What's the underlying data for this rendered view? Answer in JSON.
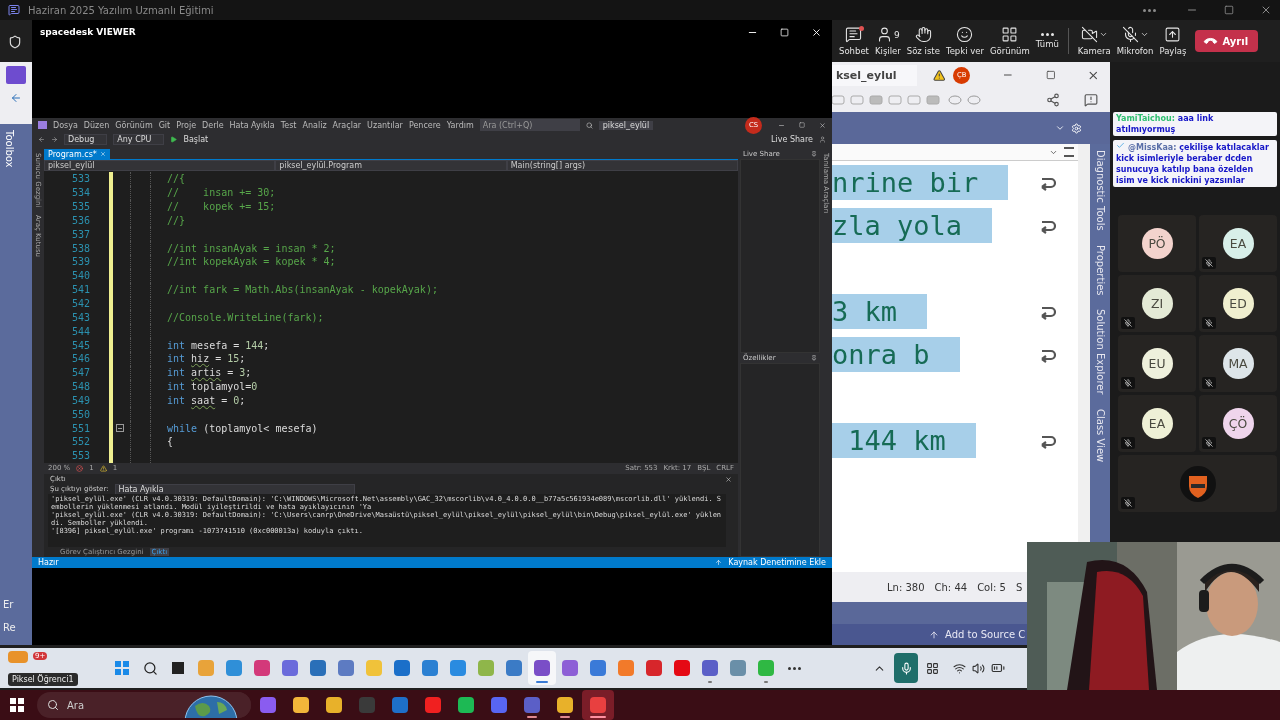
{
  "teams": {
    "title": "Haziran 2025 Yazılım Uzmanlı Eğitimi",
    "tools": [
      {
        "kind": "chat",
        "label": "Sohbet",
        "unread": true
      },
      {
        "kind": "people",
        "label": "Kişiler",
        "count": "9"
      },
      {
        "kind": "hand",
        "label": "Söz iste"
      },
      {
        "kind": "react",
        "label": "Tepki ver"
      },
      {
        "kind": "view",
        "label": "Görünüm"
      },
      {
        "kind": "more",
        "label": "Tümü"
      },
      {
        "kind": "camera",
        "label": "Kamera",
        "menu": true
      },
      {
        "kind": "mic",
        "label": "Mikrofon",
        "menu": true
      },
      {
        "kind": "share",
        "label": "Paylaş"
      }
    ],
    "leave": "Ayrıl"
  },
  "vs_background": {
    "title": "ksel_eylul",
    "user_initials": "ÇB",
    "left_tab": "Toolbox",
    "left_items": [
      "Er",
      "Re"
    ],
    "lines": [
      {
        "kind": "text",
        "text": "nrine bir"
      },
      {
        "kind": "text",
        "text": "zla yola"
      },
      {
        "kind": "blank"
      },
      {
        "kind": "text",
        "text": "3 km"
      },
      {
        "kind": "text",
        "text": "onra b"
      },
      {
        "kind": "blank"
      },
      {
        "kind": "text",
        "text": " 144 km"
      }
    ],
    "side_tabs": [
      "Diagnostic Tools",
      "Properties",
      "Solution Explorer",
      "Class View"
    ],
    "status": [
      "Ln: 380",
      "Ch: 44",
      "Col: 5",
      "S"
    ],
    "source_control": "Add to Source C"
  },
  "viewer": {
    "title": "spacedesk VIEWER"
  },
  "vs": {
    "menu": [
      "Dosya",
      "Düzen",
      "Görünüm",
      "Git",
      "Proje",
      "Derle",
      "Hata Ayıkla",
      "Test",
      "Analiz",
      "Araçlar",
      "Uzantılar",
      "Pencere",
      "Yardım"
    ],
    "search": {
      "placeholder": "Ara (Ctrl+Q)"
    },
    "solution": "piksel_eylül",
    "user_initials": "CS",
    "live_share": "Live Share",
    "config": "Debug",
    "platform": "Any CPU",
    "start": "Başlat",
    "left_tabs": [
      "Sunucu Gezgini",
      "Araç Kutusu"
    ],
    "right_tab": "Tanılama Araçları",
    "tabs": [
      {
        "label": "Program.cs*",
        "selected": true
      }
    ],
    "nav": [
      "piksel_eylül",
      "piksel_eylül.Program",
      "Main(string[] args)"
    ],
    "code": [
      {
        "n": "533",
        "segments": [
          {
            "kind": "comment",
            "text": "//{"
          }
        ]
      },
      {
        "n": "534",
        "segments": [
          {
            "kind": "comment",
            "text": "//    insan += 30;"
          }
        ]
      },
      {
        "n": "535",
        "segments": [
          {
            "kind": "comment",
            "text": "//    kopek += 15;"
          }
        ]
      },
      {
        "n": "536",
        "segments": [
          {
            "kind": "comment",
            "text": "//}"
          }
        ]
      },
      {
        "n": "537"
      },
      {
        "n": "538",
        "segments": [
          {
            "kind": "comment",
            "text": "//int insanAyak = insan * 2;"
          }
        ]
      },
      {
        "n": "539",
        "segments": [
          {
            "kind": "comment",
            "text": "//int kopekAyak = kopek * 4;"
          }
        ]
      },
      {
        "n": "540"
      },
      {
        "n": "541",
        "segments": [
          {
            "kind": "comment",
            "text": "//int fark = Math.Abs(insanAyak - kopekAyak);"
          }
        ]
      },
      {
        "n": "542"
      },
      {
        "n": "543",
        "segments": [
          {
            "kind": "comment",
            "text": "//Console.WriteLine(fark);"
          }
        ]
      },
      {
        "n": "544"
      },
      {
        "n": "545",
        "segments": [
          {
            "kind": "keyword",
            "text": "int"
          },
          {
            "kind": "plain",
            "text": " mesefa = "
          },
          {
            "kind": "number",
            "text": "144"
          },
          {
            "kind": "plain",
            "text": ";"
          }
        ]
      },
      {
        "n": "546",
        "segments": [
          {
            "kind": "keyword",
            "text": "int"
          },
          {
            "kind": "warned",
            "text": " hiz"
          },
          {
            "kind": "plain",
            "text": " = "
          },
          {
            "kind": "number",
            "text": "15"
          },
          {
            "kind": "plain",
            "text": ";"
          }
        ]
      },
      {
        "n": "547",
        "segments": [
          {
            "kind": "keyword",
            "text": "int"
          },
          {
            "kind": "warned",
            "text": " artis"
          },
          {
            "kind": "plain",
            "text": " = "
          },
          {
            "kind": "number",
            "text": "3"
          },
          {
            "kind": "plain",
            "text": ";"
          }
        ]
      },
      {
        "n": "548",
        "segments": [
          {
            "kind": "keyword",
            "text": "int"
          },
          {
            "kind": "plain",
            "text": " toplamyol="
          },
          {
            "kind": "number",
            "text": "0"
          }
        ]
      },
      {
        "n": "549",
        "segments": [
          {
            "kind": "keyword",
            "text": "int"
          },
          {
            "kind": "warned",
            "text": " saat"
          },
          {
            "kind": "plain",
            "text": " = "
          },
          {
            "kind": "number",
            "text": "0"
          },
          {
            "kind": "plain",
            "text": ";"
          }
        ]
      },
      {
        "n": "550"
      },
      {
        "n": "551",
        "foldable": true,
        "segments": [
          {
            "kind": "keyword",
            "text": "while"
          },
          {
            "kind": "plain",
            "text": " (toplamyol< mesefa)"
          }
        ]
      },
      {
        "n": "552",
        "segments": [
          {
            "kind": "plain",
            "text": "{"
          }
        ]
      },
      {
        "n": "553"
      }
    ],
    "editor_status": {
      "zoom": "200 %",
      "errors": "1",
      "warnings": "1",
      "line": "Satr: 553",
      "col": "Krkt: 17",
      "mode": "BŞL",
      "eol": "CRLF"
    },
    "output": {
      "title": "Çıktı",
      "show_label": "Şu çıktıyı göster:",
      "source": "Hata Ayıkla",
      "lines": [
        "'piksel_eylül.exe' (CLR v4.0.30319: DefaultDomain): 'C:\\WINDOWS\\Microsoft.Net\\assembly\\GAC_32\\mscorlib\\v4.0_4.0.0.0__b77a5c561934e089\\mscorlib.dll' yüklendi. Sembollerin yüklenmesi atlandı. Modül iyileştirildi ve hata ayıklayıcının 'Ya",
        "'piksel_eylül.exe' (CLR v4.0.30319: DefaultDomain): 'C:\\Users\\canrp\\OneDrive\\Masaüstü\\piksel_eylül\\piksel_eylül\\piksel_eylül\\bin\\Debug\\piksel_eylül.exe' yüklendi. Semboller yüklendi.",
        "'[8396] piksel_eylül.exe' programı -1073741510 (0xc000013a) koduyla çıktı."
      ]
    },
    "bottom_tabs": [
      {
        "label": "Görev Çalıştırıcı Gezgini",
        "selected": false
      },
      {
        "label": "Çıktı",
        "selected": true
      }
    ],
    "side_panels": [
      "Live Share",
      "Özellikler"
    ],
    "status": "Hazır",
    "source_control": "Kaynak Denetimine Ekle"
  },
  "chat": [
    {
      "author": "YamiTaichou:",
      "color": "#2fbf71",
      "pinned": false,
      "text": "aaa link atılmıyormuş"
    },
    {
      "author": "@MissKaa:",
      "color": "#5a6fa8",
      "pinned": true,
      "text": "çekilişe katılacaklar kick isimleriyle beraber dcden sunucuya katılıp bana özelden isim ve kick nickini yazsınlar"
    }
  ],
  "participants": [
    {
      "kind": "initials",
      "initials": "PÖ",
      "color": "#f3d3cd",
      "muted": false
    },
    {
      "kind": "initials",
      "initials": "EA",
      "color": "#d8efe9",
      "muted": true
    },
    {
      "kind": "initials",
      "initials": "ZI",
      "color": "#e4ead6",
      "muted": true
    },
    {
      "kind": "initials",
      "initials": "ED",
      "color": "#f0efcf",
      "muted": true
    },
    {
      "kind": "initials",
      "initials": "EU",
      "color": "#eef0dc",
      "muted": true
    },
    {
      "kind": "initials",
      "initials": "MA",
      "color": "#dde5e9",
      "muted": true
    },
    {
      "kind": "initials",
      "initials": "EA",
      "color": "#eef0d6",
      "muted": true
    },
    {
      "kind": "initials",
      "initials": "ÇÖ",
      "color": "#efd5ec",
      "muted": true
    },
    {
      "kind": "logo",
      "muted": true
    }
  ],
  "shared_taskbar": {
    "user": "Piksel Öğrenci1",
    "badge": "9+",
    "apps": [
      {
        "running": false,
        "active": false
      },
      {
        "running": false,
        "active": false
      },
      {
        "running": false,
        "active": false
      },
      {
        "running": false,
        "active": false
      },
      {
        "running": false,
        "active": false
      },
      {
        "running": false,
        "active": false
      },
      {
        "running": false,
        "active": false
      },
      {
        "running": false,
        "active": false
      },
      {
        "running": false,
        "active": false
      },
      {
        "running": false,
        "active": false
      },
      {
        "running": false,
        "active": false
      },
      {
        "running": false,
        "active": false
      },
      {
        "running": true,
        "active": true
      },
      {
        "running": false,
        "active": false
      },
      {
        "running": false,
        "active": false
      },
      {
        "running": false,
        "active": false
      },
      {
        "running": false,
        "active": false
      },
      {
        "running": false,
        "active": false
      },
      {
        "running": true,
        "active": false
      },
      {
        "running": false,
        "active": false
      },
      {
        "running": true,
        "active": false
      }
    ]
  },
  "taskbar": {
    "search": {
      "placeholder": "Ara"
    },
    "apps": [
      {
        "running": false,
        "active": false
      },
      {
        "running": false,
        "active": false
      },
      {
        "running": false,
        "active": false
      },
      {
        "running": false,
        "active": false
      },
      {
        "running": false,
        "active": false
      },
      {
        "running": false,
        "active": false
      },
      {
        "running": false,
        "active": false
      },
      {
        "running": false,
        "active": false
      },
      {
        "running": true,
        "active": false
      },
      {
        "running": true,
        "active": false
      },
      {
        "running": true,
        "active": true
      }
    ]
  }
}
